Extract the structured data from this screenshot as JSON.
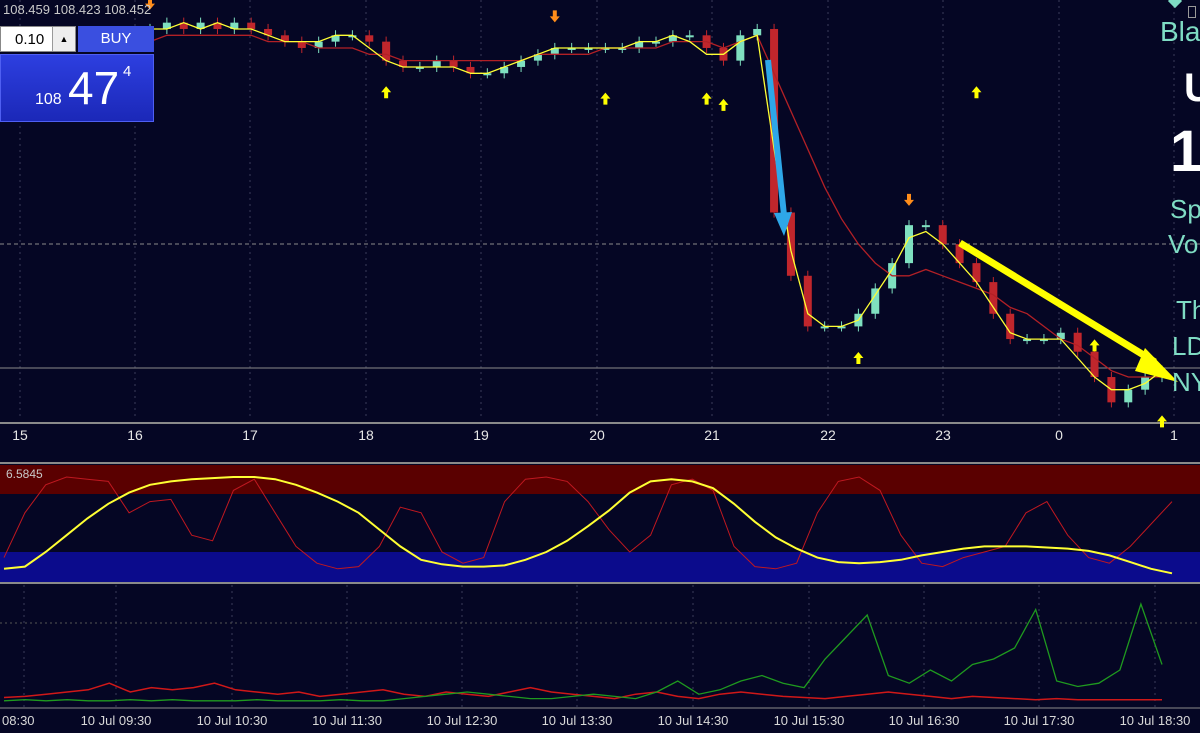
{
  "ohlc": "108.459 108.423 108.452",
  "trade_panel": {
    "lot": "0.10",
    "buy_label": "BUY",
    "price_small": "108",
    "price_big": "47",
    "price_sup": "4"
  },
  "side_labels": [
    "Bla",
    "U",
    "1",
    "Sp",
    "Vo",
    "Th",
    "LD",
    "NY"
  ],
  "oscillator_value": "6.5845",
  "colors": {
    "background": "#050624",
    "bull": "#7fe0c0",
    "bear": "#c0262c",
    "fast_ma": "#ffff33",
    "slow_ma": "#b22026",
    "buy_arrow": "#ffff00",
    "sell_arrow": "#ff8c1a",
    "blue_arrow": "#2ea7e8",
    "overbought_zone": "#5a0000",
    "oversold_zone": "#0b0b8c"
  },
  "chart_data": {
    "type": "candlestick",
    "x_hour_labels": [
      "15",
      "16",
      "17",
      "18",
      "19",
      "20",
      "21",
      "22",
      "23",
      "0",
      "1"
    ],
    "time_labels": [
      "08:30",
      "10 Jul 09:30",
      "10 Jul 10:30",
      "10 Jul 11:30",
      "10 Jul 12:30",
      "10 Jul 13:30",
      "10 Jul 14:30",
      "10 Jul 15:30",
      "10 Jul 16:30",
      "10 Jul 17:30",
      "10 Jul 18:30"
    ],
    "grid": true,
    "close": [
      108.49,
      108.5,
      108.49,
      108.5,
      108.49,
      108.5,
      108.49,
      108.48,
      108.47,
      108.46,
      108.47,
      108.48,
      108.48,
      108.47,
      108.44,
      108.43,
      108.43,
      108.44,
      108.43,
      108.42,
      108.42,
      108.43,
      108.44,
      108.45,
      108.46,
      108.46,
      108.46,
      108.46,
      108.46,
      108.47,
      108.47,
      108.48,
      108.48,
      108.46,
      108.44,
      108.48,
      108.49,
      108.2,
      108.1,
      108.02,
      108.02,
      108.02,
      108.04,
      108.08,
      108.12,
      108.18,
      108.18,
      108.15,
      108.12,
      108.09,
      108.04,
      108.0,
      108.0,
      108.0,
      108.01,
      107.98,
      107.94,
      107.9,
      107.92,
      107.94,
      107.95
    ],
    "fast_ma": [
      108.49,
      108.49,
      108.5,
      108.49,
      108.5,
      108.49,
      108.49,
      108.48,
      108.47,
      108.47,
      108.47,
      108.48,
      108.48,
      108.46,
      108.44,
      108.43,
      108.43,
      108.43,
      108.43,
      108.42,
      108.42,
      108.43,
      108.44,
      108.45,
      108.46,
      108.46,
      108.46,
      108.46,
      108.46,
      108.47,
      108.47,
      108.48,
      108.47,
      108.45,
      108.45,
      108.47,
      108.48,
      108.3,
      108.14,
      108.04,
      108.02,
      108.02,
      108.03,
      108.07,
      108.11,
      108.16,
      108.17,
      108.15,
      108.12,
      108.09,
      108.05,
      108.01,
      108.0,
      108.0,
      108.0,
      107.97,
      107.94,
      107.92,
      107.92,
      107.93,
      107.95
    ],
    "slow_ma": [
      108.47,
      108.48,
      108.48,
      108.48,
      108.48,
      108.48,
      108.48,
      108.47,
      108.47,
      108.47,
      108.46,
      108.46,
      108.46,
      108.45,
      108.45,
      108.44,
      108.44,
      108.44,
      108.44,
      108.44,
      108.44,
      108.44,
      108.44,
      108.45,
      108.45,
      108.45,
      108.45,
      108.46,
      108.46,
      108.46,
      108.46,
      108.47,
      108.47,
      108.47,
      108.46,
      108.47,
      108.48,
      108.42,
      108.36,
      108.3,
      108.24,
      108.19,
      108.15,
      108.12,
      108.1,
      108.1,
      108.11,
      108.1,
      108.09,
      108.08,
      108.07,
      108.05,
      108.04,
      108.02,
      108.0,
      107.99,
      107.97,
      107.95,
      107.94,
      107.94,
      107.94
    ],
    "oscillator_yellow": [
      10,
      12,
      25,
      40,
      55,
      68,
      78,
      85,
      88,
      90,
      91,
      92,
      92,
      90,
      85,
      78,
      70,
      60,
      45,
      30,
      18,
      14,
      12,
      12,
      13,
      18,
      25,
      35,
      48,
      62,
      78,
      88,
      90,
      88,
      82,
      68,
      52,
      38,
      28,
      20,
      16,
      15,
      16,
      18,
      22,
      25,
      28,
      30,
      30,
      30,
      29,
      28,
      26,
      22,
      16,
      10,
      6
    ],
    "oscillator_red": [
      20,
      60,
      85,
      92,
      90,
      88,
      60,
      70,
      72,
      40,
      35,
      80,
      90,
      60,
      30,
      15,
      10,
      12,
      30,
      65,
      60,
      25,
      15,
      20,
      70,
      90,
      92,
      88,
      70,
      45,
      25,
      40,
      85,
      90,
      80,
      30,
      12,
      10,
      15,
      60,
      88,
      92,
      80,
      40,
      15,
      12,
      20,
      25,
      30,
      60,
      70,
      40,
      20,
      15,
      30,
      50,
      70
    ]
  }
}
